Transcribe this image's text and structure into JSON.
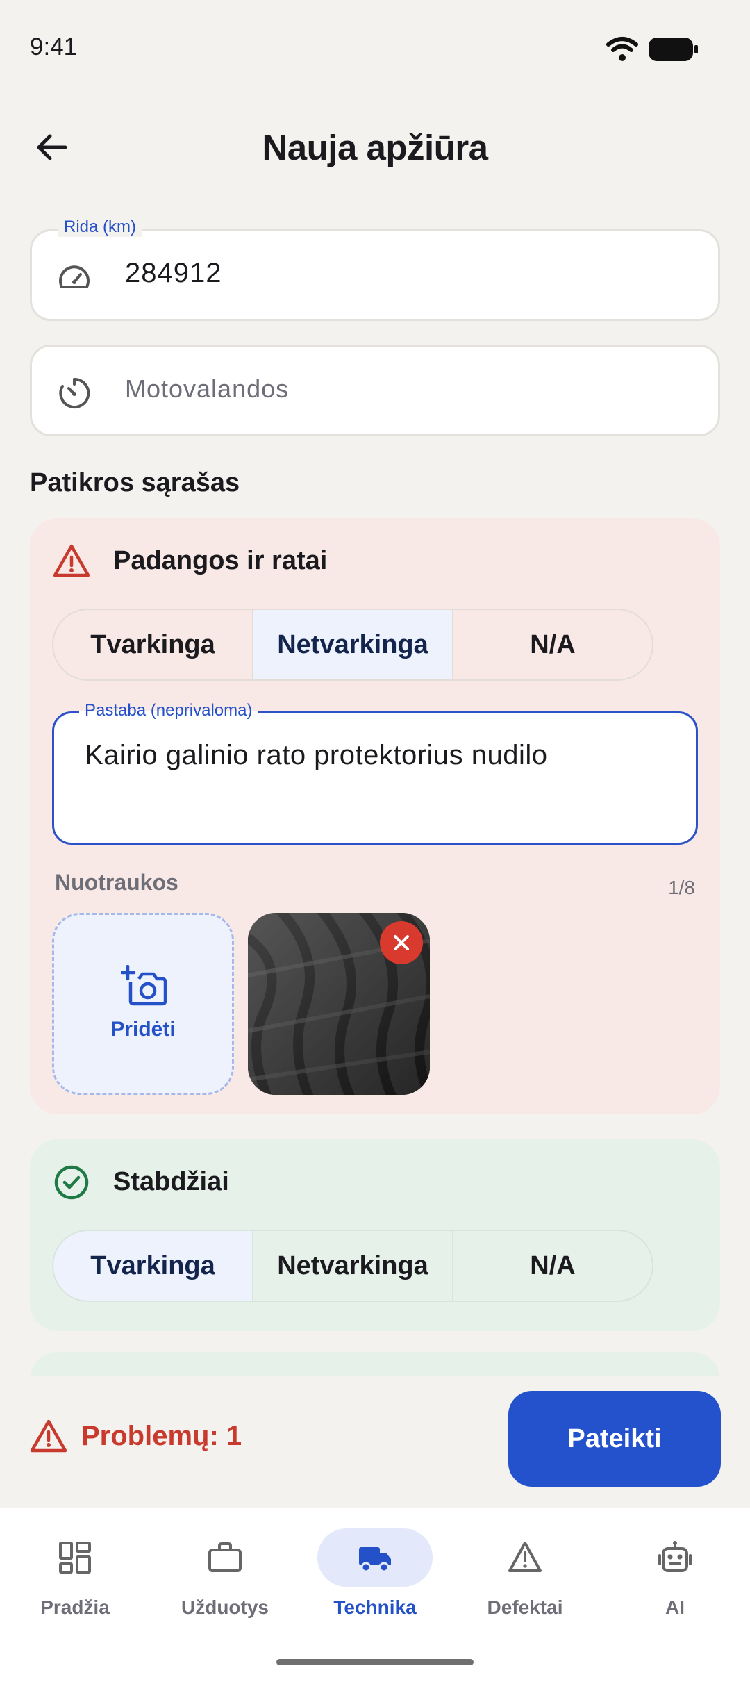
{
  "status_bar": {
    "time": "9:41"
  },
  "header": {
    "title": "Nauja apžiūra"
  },
  "fields": {
    "rida": {
      "label": "Rida (km)",
      "value": "284912",
      "icon": "speedometer-icon"
    },
    "motovalandos": {
      "placeholder": "Motovalandos",
      "icon": "timer-icon"
    }
  },
  "checklist": {
    "title": "Patikros sąrašas",
    "items": [
      {
        "name": "Padangos ir ratai",
        "status_icon": "warning-icon",
        "options": [
          "Tvarkinga",
          "Netvarkinga",
          "N/A"
        ],
        "selected": "Netvarkinga",
        "note_label": "Pastaba (neprivaloma)",
        "note_value": "Kairio galinio rato protektorius nudilo",
        "photos_label": "Nuotraukos",
        "photos_count": "1/8",
        "add_photo_label": "Pridėti"
      },
      {
        "name": "Stabdžiai",
        "status_icon": "check-circle-icon",
        "options": [
          "Tvarkinga",
          "Netvarkinga",
          "N/A"
        ],
        "selected": "Tvarkinga"
      }
    ]
  },
  "footer": {
    "problems": "Problemų: 1",
    "submit": "Pateikti"
  },
  "nav": {
    "items": [
      {
        "label": "Pradžia",
        "icon": "dashboard-icon"
      },
      {
        "label": "Užduotys",
        "icon": "briefcase-icon"
      },
      {
        "label": "Technika",
        "icon": "truck-icon"
      },
      {
        "label": "Defektai",
        "icon": "warning-icon"
      },
      {
        "label": "AI",
        "icon": "robot-icon"
      }
    ],
    "active": "Technika"
  },
  "colors": {
    "accent": "#2352cc",
    "danger": "#c93a2e",
    "success": "#1f7a45",
    "fail_card": "#f8e9e6",
    "ok_card": "#e6f1e9"
  }
}
